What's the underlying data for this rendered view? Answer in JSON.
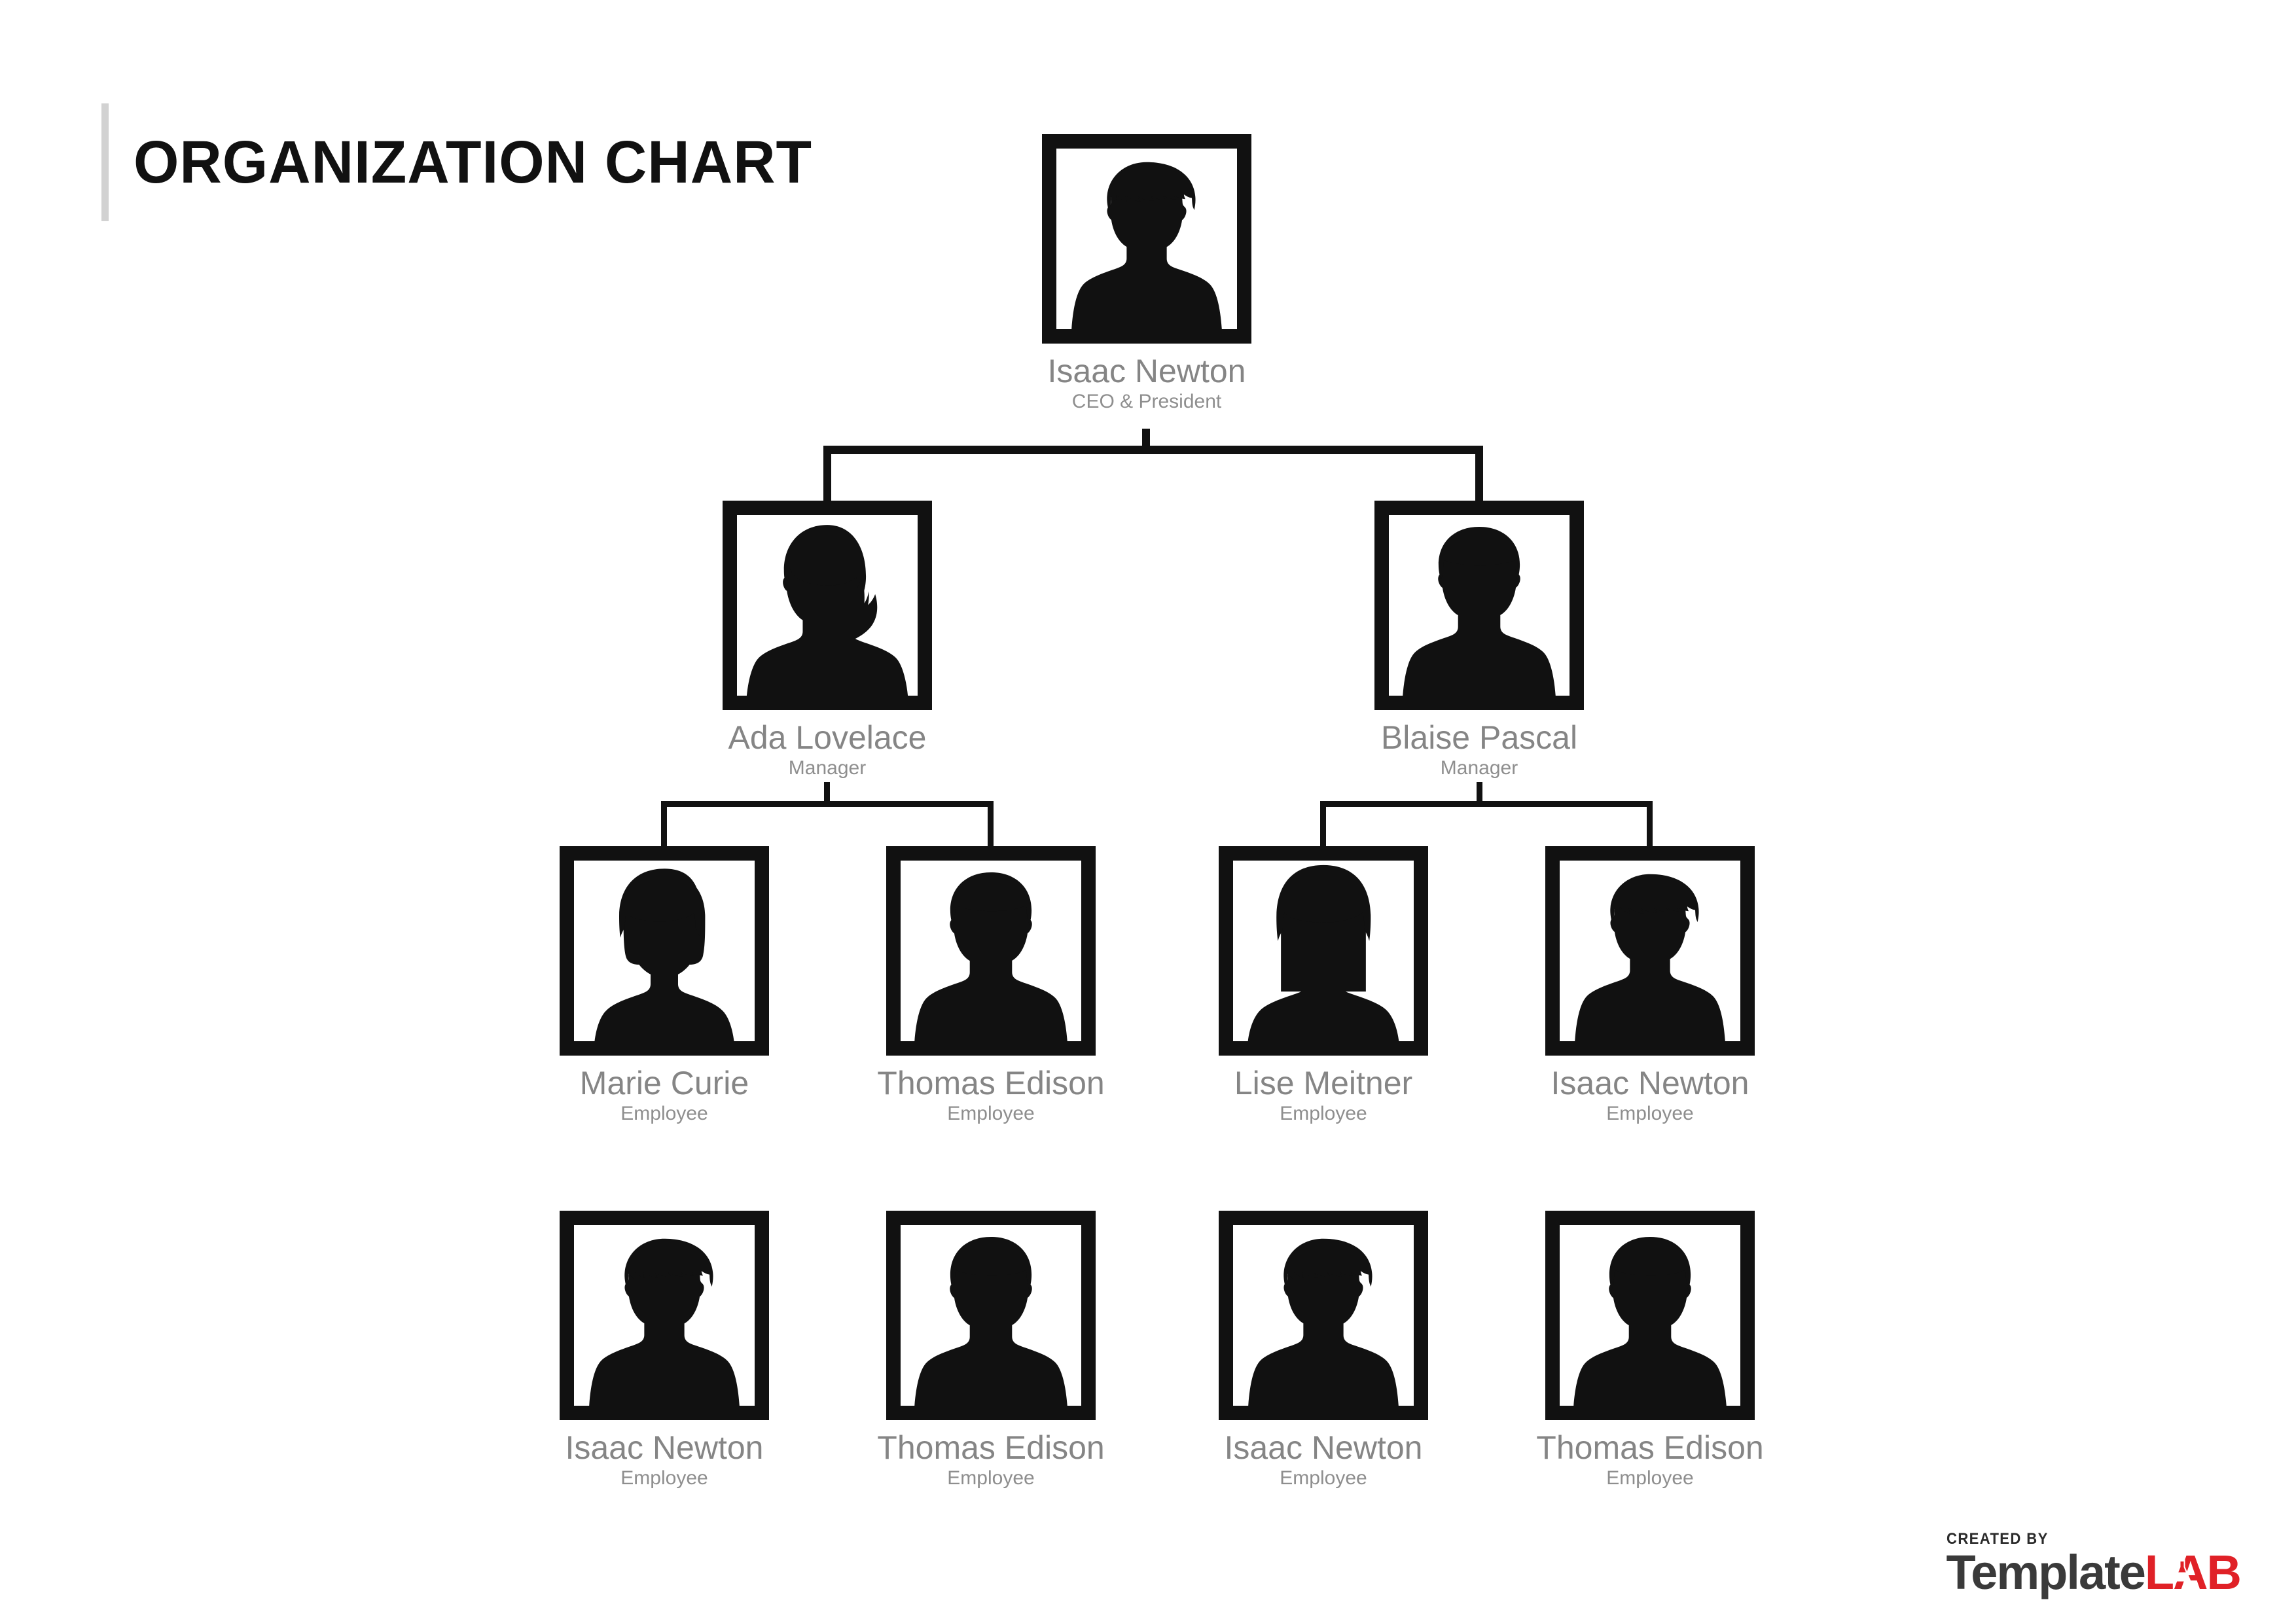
{
  "page": {
    "title": "ORGANIZATION CHART",
    "background_color": "#ffffff",
    "title_color": "#111111",
    "title_rule_color": "#d2d2d2",
    "name_color": "#858585",
    "role_color": "#8e8e8e",
    "frame_color": "#111111",
    "connector_color": "#111111"
  },
  "chart_data": {
    "type": "org-chart",
    "title": "ORGANIZATION CHART",
    "levels": 4,
    "nodes": [
      {
        "id": "n1",
        "name": "Isaac Newton",
        "role": "CEO & President",
        "level": 1,
        "parent": null,
        "avatar": "male-curly-hair-avatar"
      },
      {
        "id": "n2",
        "name": "Ada Lovelace",
        "role": "Manager",
        "level": 2,
        "parent": "n1",
        "avatar": "female-ponytail-avatar"
      },
      {
        "id": "n3",
        "name": "Blaise Pascal",
        "role": "Manager",
        "level": 2,
        "parent": "n1",
        "avatar": "male-short-hair-avatar"
      },
      {
        "id": "n4",
        "name": "Marie Curie",
        "role": "Employee",
        "level": 3,
        "parent": "n2",
        "avatar": "female-bob-hair-avatar"
      },
      {
        "id": "n5",
        "name": "Thomas Edison",
        "role": "Employee",
        "level": 3,
        "parent": "n2",
        "avatar": "male-short-hair-avatar"
      },
      {
        "id": "n6",
        "name": "Lise Meitner",
        "role": "Employee",
        "level": 3,
        "parent": "n3",
        "avatar": "female-long-hair-avatar"
      },
      {
        "id": "n7",
        "name": "Isaac Newton",
        "role": "Employee",
        "level": 3,
        "parent": "n3",
        "avatar": "male-curly-hair-avatar"
      },
      {
        "id": "n8",
        "name": "Isaac Newton",
        "role": "Employee",
        "level": 4,
        "parent": null,
        "avatar": "male-curly-hair-avatar"
      },
      {
        "id": "n9",
        "name": "Thomas Edison",
        "role": "Employee",
        "level": 4,
        "parent": null,
        "avatar": "male-short-hair-avatar"
      },
      {
        "id": "n10",
        "name": "Isaac Newton",
        "role": "Employee",
        "level": 4,
        "parent": null,
        "avatar": "male-curly-hair-avatar"
      },
      {
        "id": "n11",
        "name": "Thomas Edison",
        "role": "Employee",
        "level": 4,
        "parent": null,
        "avatar": "male-short-hair-avatar"
      }
    ]
  },
  "footer": {
    "created_by": "CREATED BY",
    "brand_dark": "Template",
    "brand_red": "LAB",
    "brand_red_color": "#e02127",
    "brand_dark_color": "#3a3a3a"
  }
}
